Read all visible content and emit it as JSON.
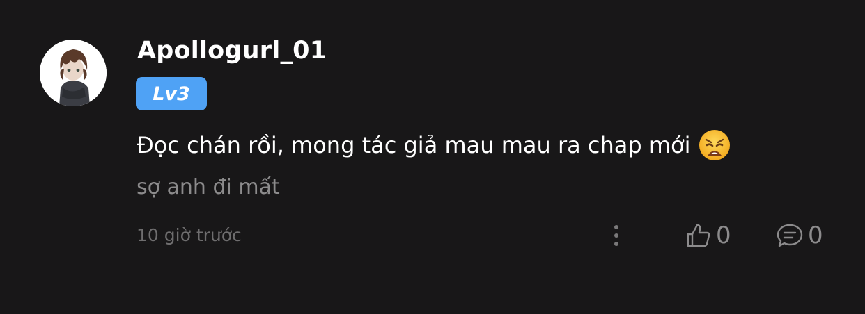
{
  "comment": {
    "username": "Apollogurl_01",
    "level_badge": "Lv3",
    "text": "Đọc chán rồi, mong tác giả mau mau ra chap mới",
    "emoji": "weary-face",
    "quote": "sợ anh đi mất",
    "timestamp": "10 giờ trước",
    "likes": "0",
    "replies": "0"
  },
  "colors": {
    "background": "#181718",
    "badge": "#4fa2f5",
    "muted_text": "#8c8b8c"
  },
  "icons": {
    "more": "more-vertical-icon",
    "like": "thumbs-up-icon",
    "reply": "comment-bubble-icon"
  }
}
